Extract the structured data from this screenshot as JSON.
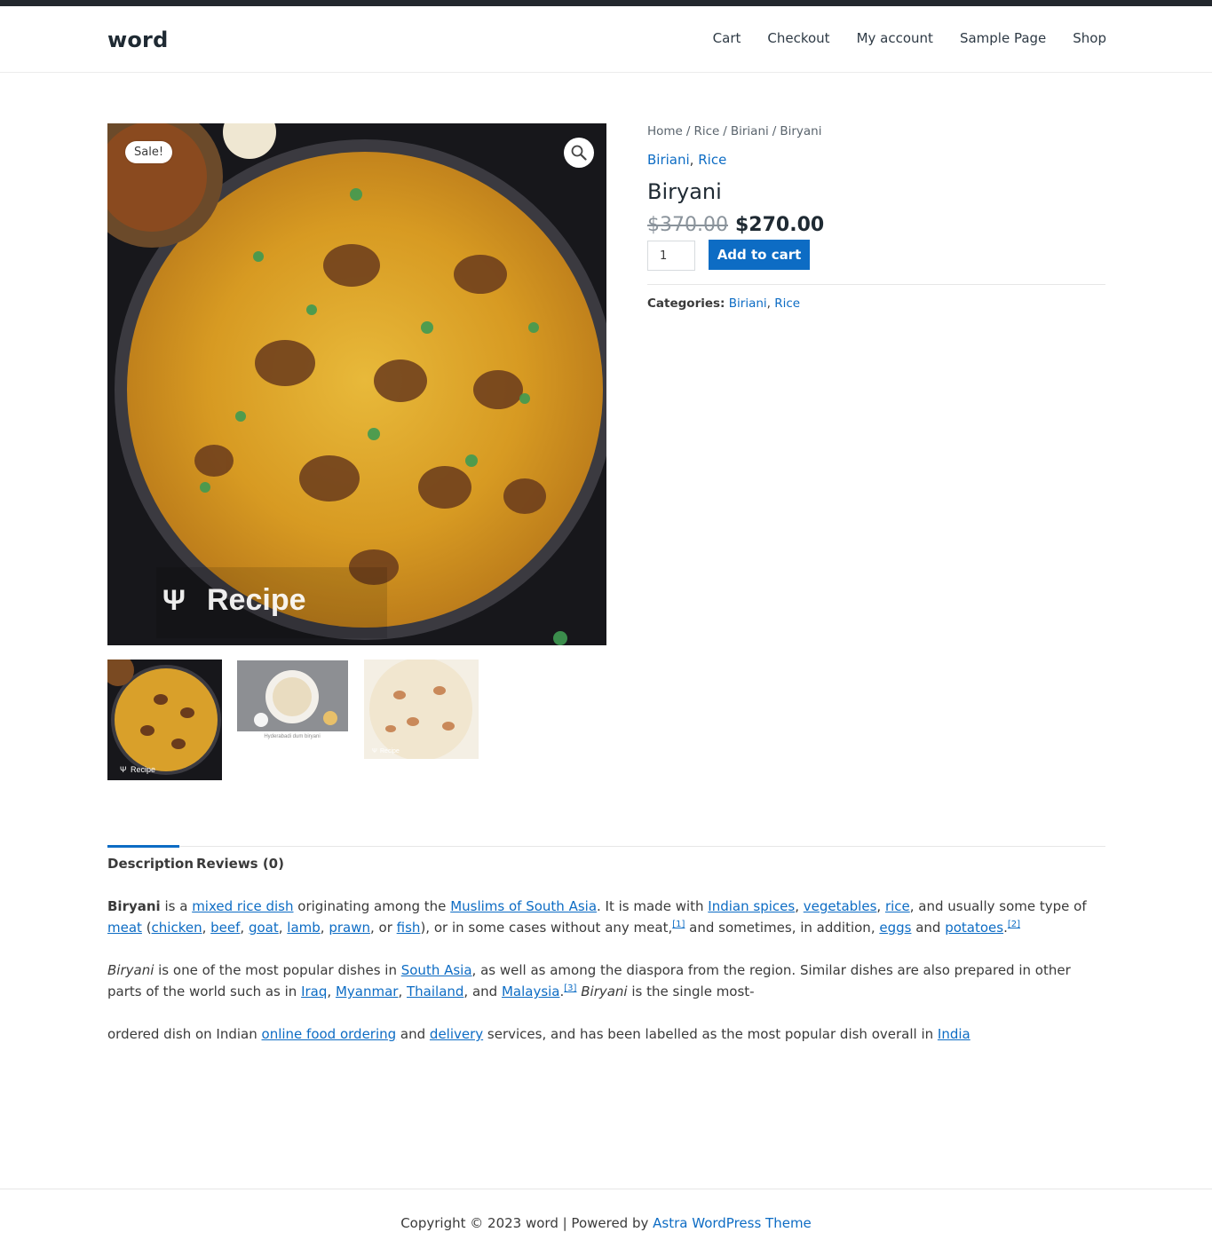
{
  "site": {
    "title": "word"
  },
  "nav": {
    "items": [
      "Cart",
      "Checkout",
      "My account",
      "Sample Page",
      "Shop"
    ]
  },
  "gallery": {
    "sale_badge": "Sale!",
    "main_watermark": "Recipe",
    "thumbs": [
      {
        "caption": "Recipe"
      },
      {
        "caption": "Hyderabadi dum biryani"
      },
      {
        "caption": "Recipe"
      }
    ]
  },
  "breadcrumb": {
    "items": [
      "Home",
      "Rice",
      "Biriani",
      "Biryani"
    ],
    "separator": "/"
  },
  "product": {
    "categories": [
      "Biriani",
      "Rice"
    ],
    "title": "Biryani",
    "price_old": "$370.00",
    "price_new": "$270.00",
    "quantity": "1",
    "add_to_cart_label": "Add to cart",
    "meta_label": "Categories:",
    "comma": ","
  },
  "tabs": {
    "description": "Description",
    "reviews": "Reviews (0)"
  },
  "description": {
    "p1": {
      "bold": "Biryani",
      "t1": " is a ",
      "l_mixed": "mixed rice dish",
      "t2": " originating among the ",
      "l_muslims": "Muslims of South Asia",
      "t3": ". It is made with ",
      "l_spices": "Indian spices",
      "t4": ", ",
      "l_veg": "vegetables",
      "t5": ", ",
      "l_rice": "rice",
      "t6": ", and usually some type of ",
      "l_meat": "meat",
      "t7": " (",
      "l_chicken": "chicken",
      "t8": ", ",
      "l_beef": "beef",
      "t9": ", ",
      "l_goat": "goat",
      "t10": ", ",
      "l_lamb": "lamb",
      "t11": ", ",
      "l_prawn": "prawn",
      "t12": ", or ",
      "l_fish": "fish",
      "t13": "), or in some cases without any meat,",
      "ref1": "[1]",
      "t14": " and sometimes, in addition, ",
      "l_eggs": "eggs",
      "t15": " and ",
      "l_potatoes": "potatoes",
      "t16": ".",
      "ref2": "[2]"
    },
    "p2": {
      "em": "Biryani",
      "t1": " is one of the most popular dishes in ",
      "l_southasia": "South Asia",
      "t2": ", as well as among the diaspora from the region. Similar dishes are also prepared in other parts of the world such as in ",
      "l_iraq": "Iraq",
      "t3": ", ",
      "l_myanmar": "Myanmar",
      "t4": ", ",
      "l_thailand": "Thailand",
      "t5": ", and ",
      "l_malaysia": "Malaysia",
      "t6": ".",
      "ref3": "[3]",
      "t7": " ",
      "em2": "Biryani",
      "t8": " is the single most-"
    },
    "p3": {
      "t1": "ordered dish on Indian ",
      "l_online": "online food ordering",
      "t2": " and ",
      "l_delivery": "delivery",
      "t3": " services, and has been labelled as the most popular dish overall in ",
      "l_india": "India"
    }
  },
  "footer": {
    "text": "Copyright © 2023 word | Powered by ",
    "link": "Astra WordPress Theme"
  },
  "colors": {
    "accent": "#0d6cc4",
    "header_bar": "#23282d"
  }
}
